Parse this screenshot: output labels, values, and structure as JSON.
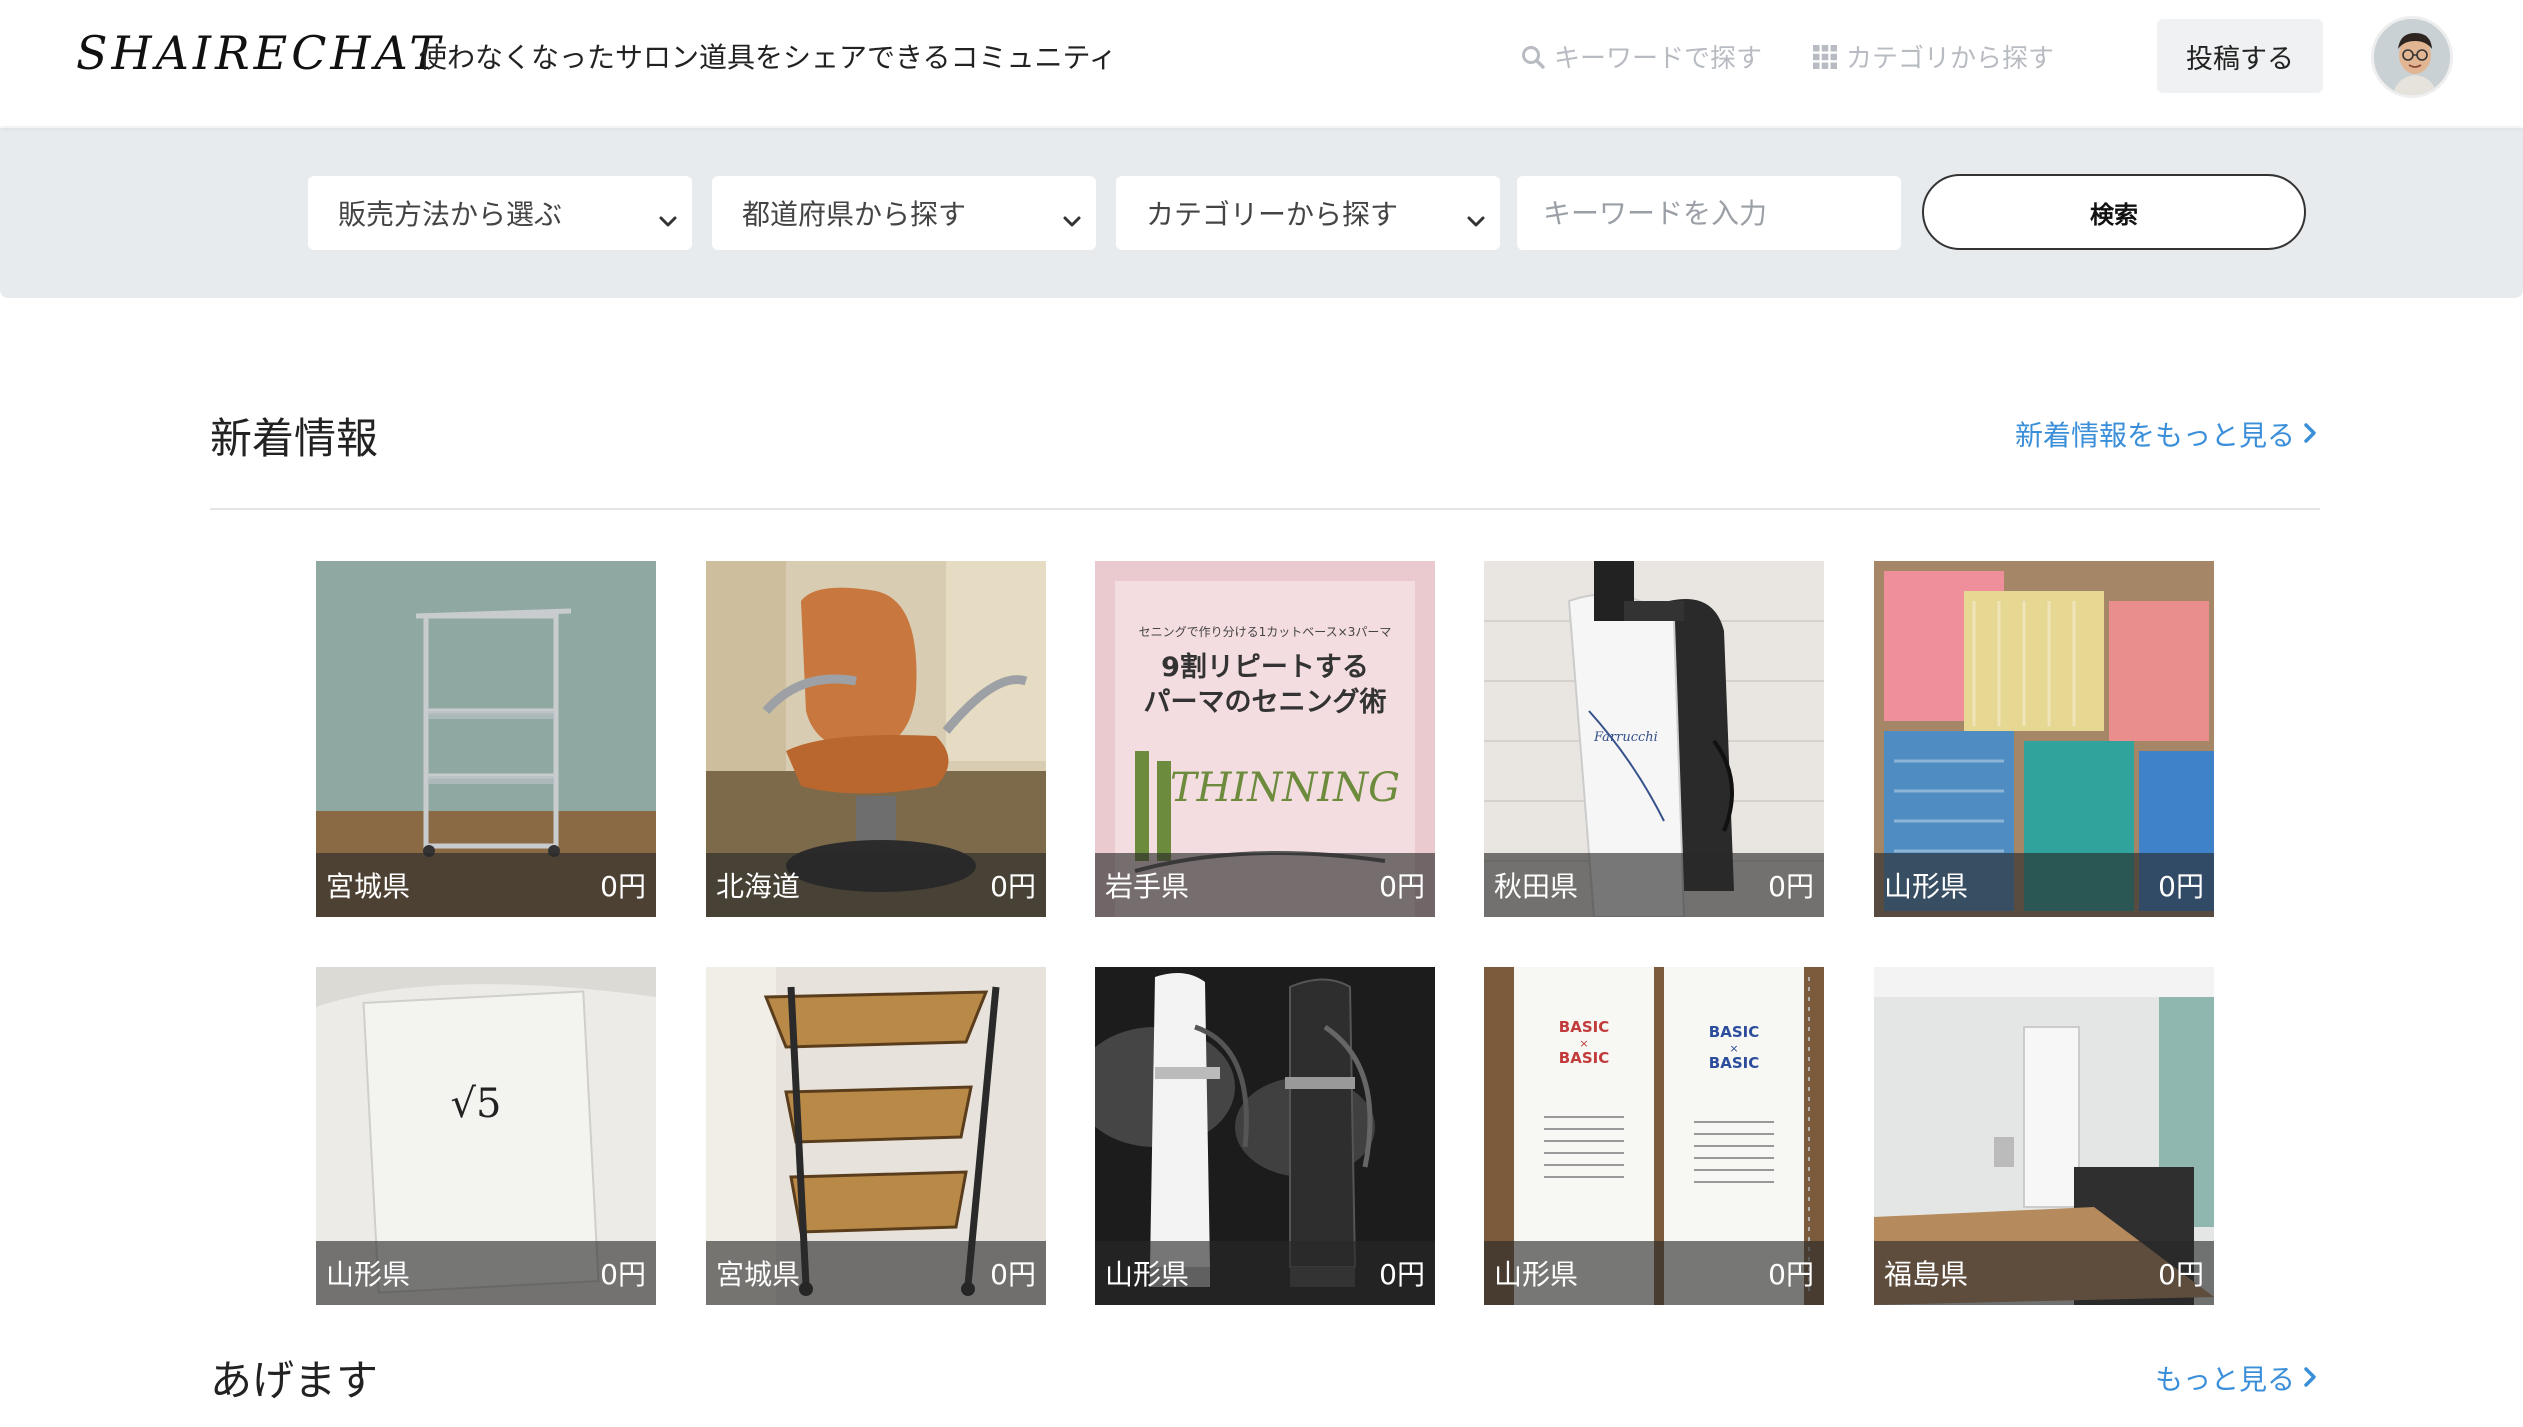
{
  "header": {
    "logo": "SHAIRECHAT",
    "tagline": "使わなくなったサロン道具をシェアできるコミュニティ",
    "nav_search": "キーワードで探す",
    "nav_category": "カテゴリから探す",
    "post_button": "投稿する"
  },
  "search": {
    "sales_method": "販売方法から選ぶ",
    "prefecture": "都道府県から探す",
    "category": "カテゴリーから探す",
    "keyword_placeholder": "キーワードを入力",
    "submit": "検索"
  },
  "sections": {
    "new_title": "新着情報",
    "new_more": "新着情報をもっと見る",
    "give_title": "あげます",
    "give_more": "もっと見る"
  },
  "items": [
    {
      "prefecture": "宮城県",
      "price": "0円",
      "image": "stainless-trolley"
    },
    {
      "prefecture": "北海道",
      "price": "0円",
      "image": "salon-chair"
    },
    {
      "prefecture": "岩手県",
      "price": "0円",
      "image": "book-thinning"
    },
    {
      "prefecture": "秋田県",
      "price": "0円",
      "image": "hair-steamer"
    },
    {
      "prefecture": "山形県",
      "price": "0円",
      "image": "perm-rods"
    },
    {
      "prefecture": "山形県",
      "price": "0円",
      "image": "white-book"
    },
    {
      "prefecture": "宮城県",
      "price": "0円",
      "image": "wooden-trolley"
    },
    {
      "prefecture": "山形県",
      "price": "0円",
      "image": "steamers-pair"
    },
    {
      "prefecture": "山形県",
      "price": "0円",
      "image": "basic-books"
    },
    {
      "prefecture": "福島県",
      "price": "0円",
      "image": "empty-room"
    }
  ],
  "book_texts": {
    "thinning_subtitle": "セニングで作り分ける1カットベース×3パーマ",
    "thinning_title_1": "9割リピートする",
    "thinning_title_2": "パーマのセニング術",
    "thinning_word": "THINNING",
    "sqrt5": "√5",
    "basic": "BASIC",
    "times": "×",
    "brand": "Farrucchi"
  }
}
